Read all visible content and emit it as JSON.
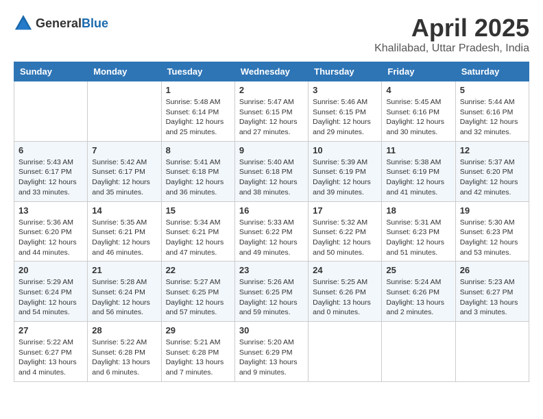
{
  "logo": {
    "general": "General",
    "blue": "Blue"
  },
  "header": {
    "month": "April 2025",
    "location": "Khalilabad, Uttar Pradesh, India"
  },
  "weekdays": [
    "Sunday",
    "Monday",
    "Tuesday",
    "Wednesday",
    "Thursday",
    "Friday",
    "Saturday"
  ],
  "weeks": [
    [
      {
        "day": "",
        "info": ""
      },
      {
        "day": "",
        "info": ""
      },
      {
        "day": "1",
        "info": "Sunrise: 5:48 AM\nSunset: 6:14 PM\nDaylight: 12 hours and 25 minutes."
      },
      {
        "day": "2",
        "info": "Sunrise: 5:47 AM\nSunset: 6:15 PM\nDaylight: 12 hours and 27 minutes."
      },
      {
        "day": "3",
        "info": "Sunrise: 5:46 AM\nSunset: 6:15 PM\nDaylight: 12 hours and 29 minutes."
      },
      {
        "day": "4",
        "info": "Sunrise: 5:45 AM\nSunset: 6:16 PM\nDaylight: 12 hours and 30 minutes."
      },
      {
        "day": "5",
        "info": "Sunrise: 5:44 AM\nSunset: 6:16 PM\nDaylight: 12 hours and 32 minutes."
      }
    ],
    [
      {
        "day": "6",
        "info": "Sunrise: 5:43 AM\nSunset: 6:17 PM\nDaylight: 12 hours and 33 minutes."
      },
      {
        "day": "7",
        "info": "Sunrise: 5:42 AM\nSunset: 6:17 PM\nDaylight: 12 hours and 35 minutes."
      },
      {
        "day": "8",
        "info": "Sunrise: 5:41 AM\nSunset: 6:18 PM\nDaylight: 12 hours and 36 minutes."
      },
      {
        "day": "9",
        "info": "Sunrise: 5:40 AM\nSunset: 6:18 PM\nDaylight: 12 hours and 38 minutes."
      },
      {
        "day": "10",
        "info": "Sunrise: 5:39 AM\nSunset: 6:19 PM\nDaylight: 12 hours and 39 minutes."
      },
      {
        "day": "11",
        "info": "Sunrise: 5:38 AM\nSunset: 6:19 PM\nDaylight: 12 hours and 41 minutes."
      },
      {
        "day": "12",
        "info": "Sunrise: 5:37 AM\nSunset: 6:20 PM\nDaylight: 12 hours and 42 minutes."
      }
    ],
    [
      {
        "day": "13",
        "info": "Sunrise: 5:36 AM\nSunset: 6:20 PM\nDaylight: 12 hours and 44 minutes."
      },
      {
        "day": "14",
        "info": "Sunrise: 5:35 AM\nSunset: 6:21 PM\nDaylight: 12 hours and 46 minutes."
      },
      {
        "day": "15",
        "info": "Sunrise: 5:34 AM\nSunset: 6:21 PM\nDaylight: 12 hours and 47 minutes."
      },
      {
        "day": "16",
        "info": "Sunrise: 5:33 AM\nSunset: 6:22 PM\nDaylight: 12 hours and 49 minutes."
      },
      {
        "day": "17",
        "info": "Sunrise: 5:32 AM\nSunset: 6:22 PM\nDaylight: 12 hours and 50 minutes."
      },
      {
        "day": "18",
        "info": "Sunrise: 5:31 AM\nSunset: 6:23 PM\nDaylight: 12 hours and 51 minutes."
      },
      {
        "day": "19",
        "info": "Sunrise: 5:30 AM\nSunset: 6:23 PM\nDaylight: 12 hours and 53 minutes."
      }
    ],
    [
      {
        "day": "20",
        "info": "Sunrise: 5:29 AM\nSunset: 6:24 PM\nDaylight: 12 hours and 54 minutes."
      },
      {
        "day": "21",
        "info": "Sunrise: 5:28 AM\nSunset: 6:24 PM\nDaylight: 12 hours and 56 minutes."
      },
      {
        "day": "22",
        "info": "Sunrise: 5:27 AM\nSunset: 6:25 PM\nDaylight: 12 hours and 57 minutes."
      },
      {
        "day": "23",
        "info": "Sunrise: 5:26 AM\nSunset: 6:25 PM\nDaylight: 12 hours and 59 minutes."
      },
      {
        "day": "24",
        "info": "Sunrise: 5:25 AM\nSunset: 6:26 PM\nDaylight: 13 hours and 0 minutes."
      },
      {
        "day": "25",
        "info": "Sunrise: 5:24 AM\nSunset: 6:26 PM\nDaylight: 13 hours and 2 minutes."
      },
      {
        "day": "26",
        "info": "Sunrise: 5:23 AM\nSunset: 6:27 PM\nDaylight: 13 hours and 3 minutes."
      }
    ],
    [
      {
        "day": "27",
        "info": "Sunrise: 5:22 AM\nSunset: 6:27 PM\nDaylight: 13 hours and 4 minutes."
      },
      {
        "day": "28",
        "info": "Sunrise: 5:22 AM\nSunset: 6:28 PM\nDaylight: 13 hours and 6 minutes."
      },
      {
        "day": "29",
        "info": "Sunrise: 5:21 AM\nSunset: 6:28 PM\nDaylight: 13 hours and 7 minutes."
      },
      {
        "day": "30",
        "info": "Sunrise: 5:20 AM\nSunset: 6:29 PM\nDaylight: 13 hours and 9 minutes."
      },
      {
        "day": "",
        "info": ""
      },
      {
        "day": "",
        "info": ""
      },
      {
        "day": "",
        "info": ""
      }
    ]
  ]
}
